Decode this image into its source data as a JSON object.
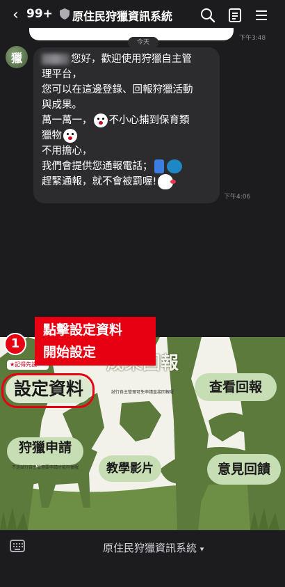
{
  "header": {
    "back_glyph": "‹",
    "unread_count": "99+",
    "title": "原住民狩獵資訊系統",
    "icons": [
      "back-icon",
      "shield-icon",
      "search-icon",
      "notes-icon",
      "menu-icon"
    ]
  },
  "chat": {
    "date_label": "今天",
    "prev_time": "下午3:48",
    "avatar_text": "獵",
    "message": {
      "line1_after_name": "您好，歡迎使用狩獵自主管",
      "line2": "理平台，",
      "line3": "您可以在這邊登錄、回報狩獵活動",
      "line4": "與成果。",
      "line5_a": "萬一萬一，",
      "line5_b": "不小心捕到保育類",
      "line6": "獵物",
      "line7": "不用擔心，",
      "line8": "我們會提供您通報電話；",
      "line9": "趕緊通報，就不會被罰喔!",
      "time": "下午4:06"
    }
  },
  "annotation": {
    "step_number": "1",
    "line1": "點擊設定資料",
    "line2": "開始設定"
  },
  "rich_menu": {
    "tag": "★記得先設",
    "settings": "設定資料",
    "results": "成果回報",
    "results_sub": "試行自主管理可免申請直接回報喔",
    "view_reports": "查看回報",
    "apply": "狩獵申請",
    "apply_sub": "不是試行自主管理要申請才能狩獵喔",
    "tutorial": "教學影片",
    "feedback": "意見回饋"
  },
  "bottom_bar": {
    "menu_label": "原住民狩獵資訊系統",
    "caret": "▾"
  },
  "colors": {
    "background": "#1c1c1e",
    "bubble": "#2c2c2e",
    "accent_red": "#e60012",
    "silhouette_green": "#5b7a3c",
    "pill_green": "#c7ddb4"
  }
}
